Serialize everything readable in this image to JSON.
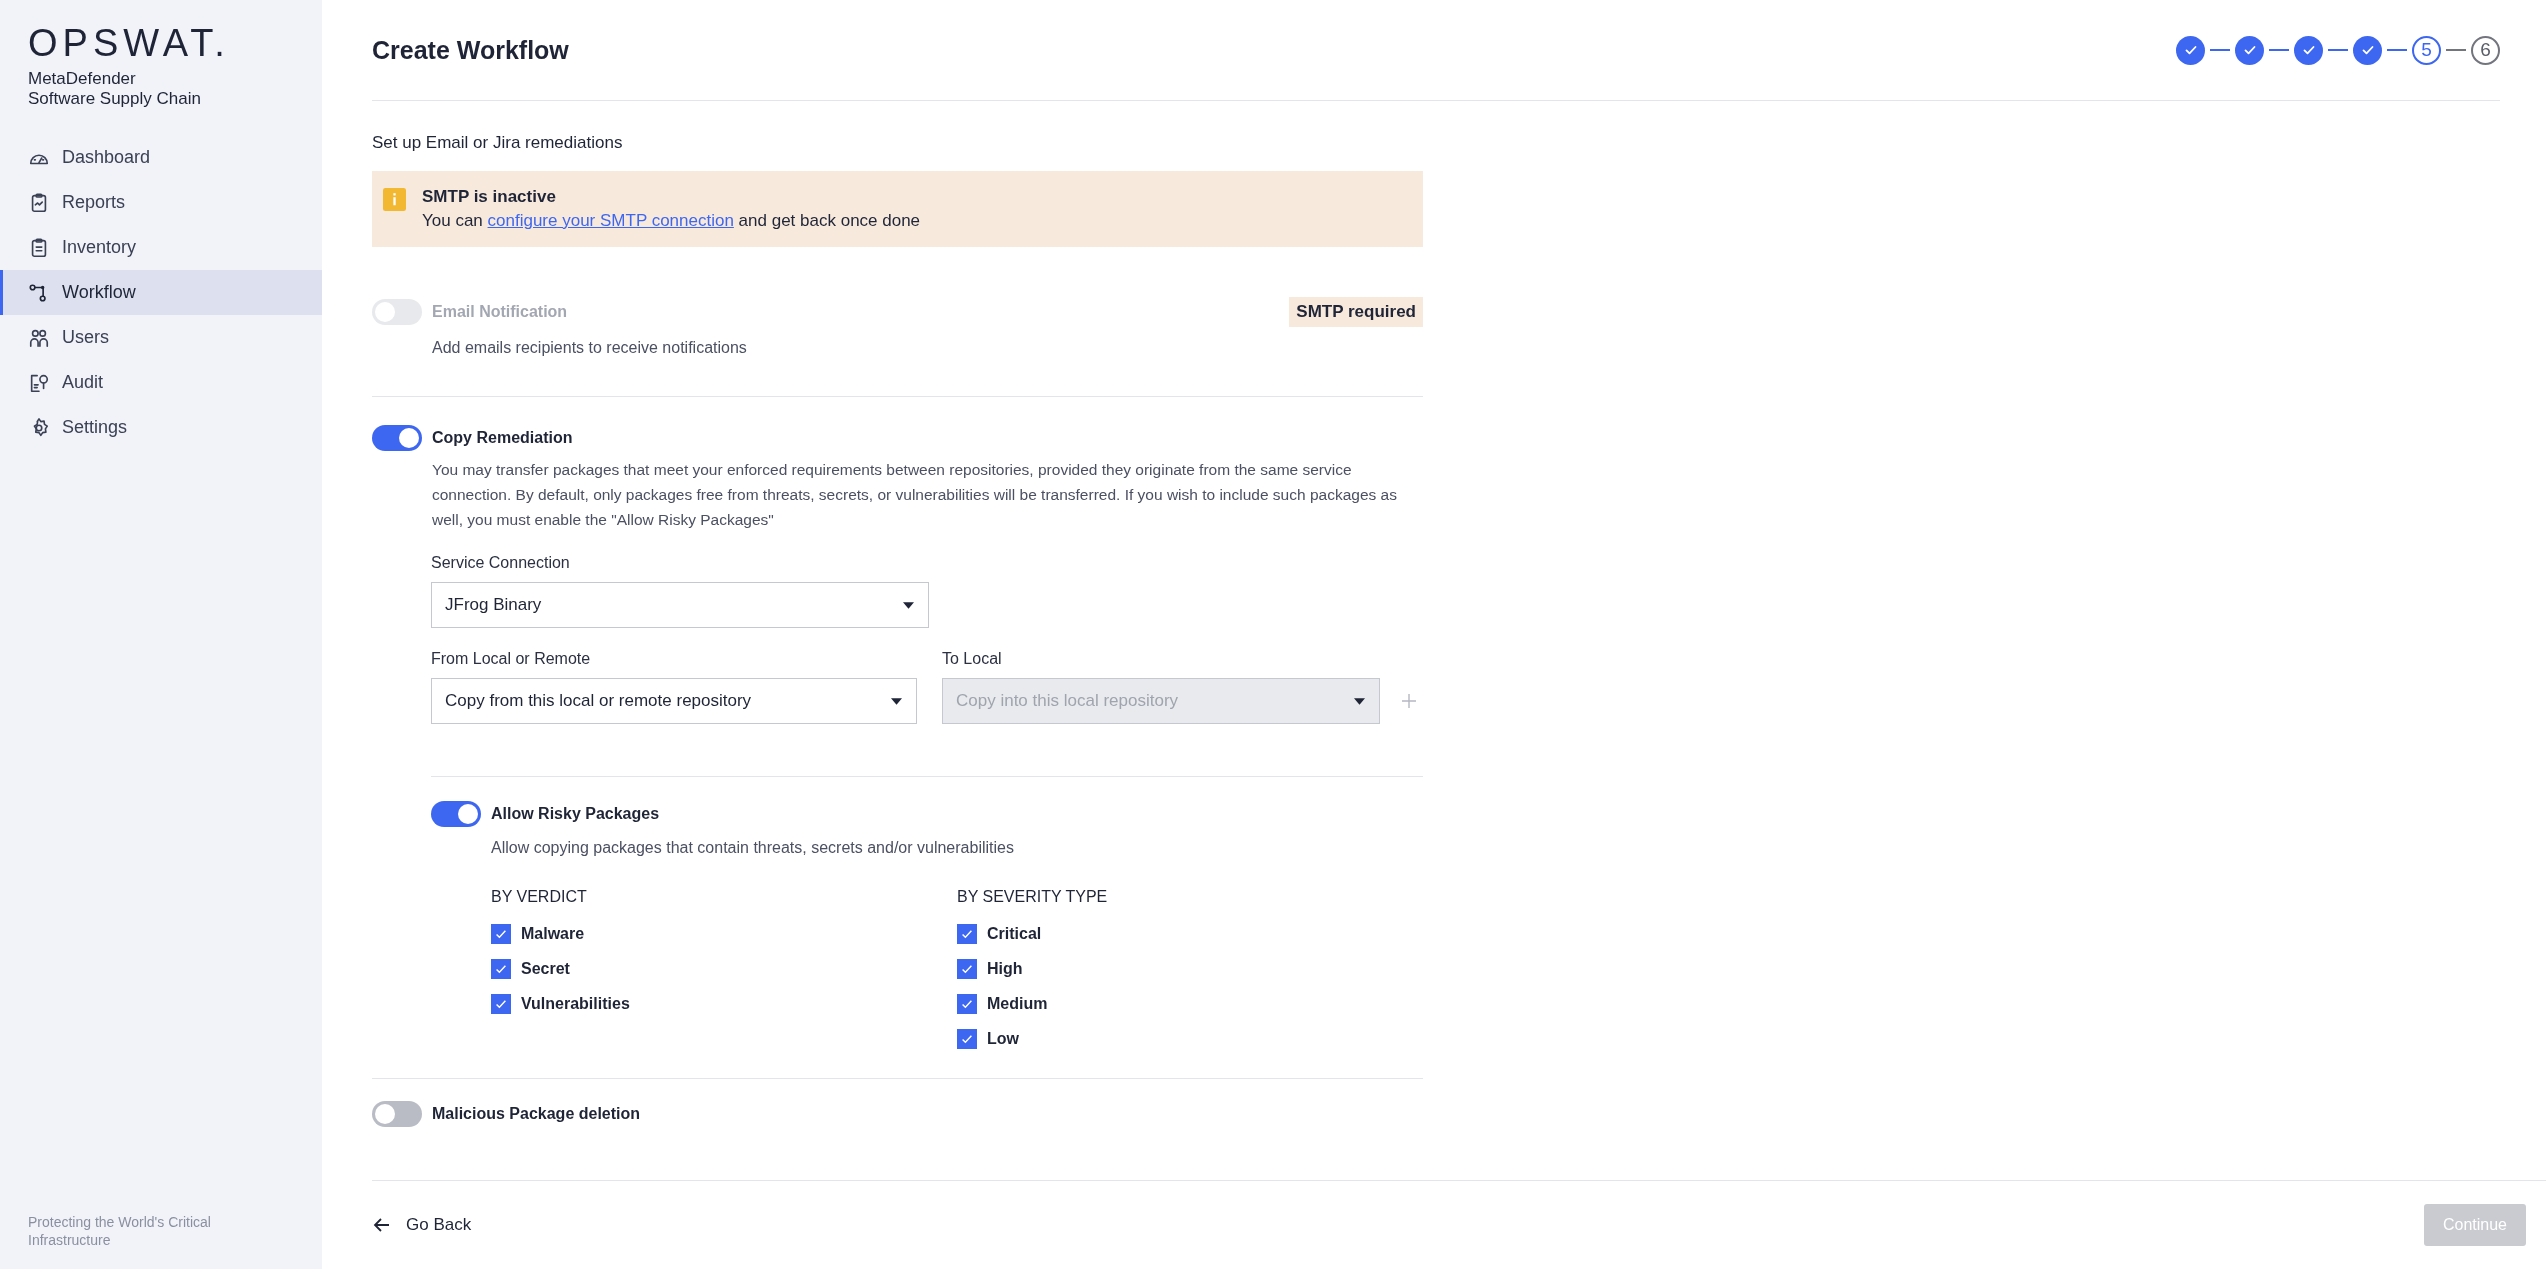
{
  "sidebar": {
    "logo": "OPSWAT.",
    "product": "MetaDefender",
    "subtitle": "Software Supply Chain",
    "items": [
      {
        "label": "Dashboard",
        "selected": false
      },
      {
        "label": "Reports",
        "selected": false
      },
      {
        "label": "Inventory",
        "selected": false
      },
      {
        "label": "Workflow",
        "selected": true
      },
      {
        "label": "Users",
        "selected": false
      },
      {
        "label": "Audit",
        "selected": false
      },
      {
        "label": "Settings",
        "selected": false
      }
    ],
    "footer": "Protecting the World's Critical Infrastructure"
  },
  "header": {
    "title": "Create Workflow"
  },
  "stepper": [
    {
      "completed": true,
      "active": false
    },
    {
      "completed": true,
      "active": false
    },
    {
      "completed": true,
      "active": false
    },
    {
      "completed": true,
      "active": false
    },
    {
      "label": "5",
      "completed": false,
      "active": true
    },
    {
      "label": "6",
      "completed": false,
      "active": false
    }
  ],
  "intro": "Set up Email or Jira remediations",
  "alert": {
    "title": "SMTP is inactive",
    "text_before": "You can",
    "link": "configure your SMTP connection",
    "text_after": "and get back once done"
  },
  "email": {
    "label": "Email Notification",
    "on": false,
    "disabled": true,
    "description": "Add emails recipients to receive notifications",
    "badge": "SMTP required"
  },
  "copy": {
    "label": "Copy Remediation",
    "on": true,
    "disabled": false,
    "description": "You may transfer packages that meet your enforced requirements between repositories, provided they originate from the same service connection. By default, only packages free from threats, secrets, or vulnerabilities will be transferred. If you wish to include such packages as well, you must enable the \"Allow Risky Packages\"",
    "service": {
      "label": "Service Connection",
      "value": "JFrog Binary",
      "disabled": false
    },
    "from": {
      "label": "From Local or Remote",
      "value": "Copy from this local or remote repository",
      "disabled": false
    },
    "to": {
      "label": "To Local",
      "placeholder": "Copy into this local repository",
      "disabled": true
    },
    "risky": {
      "label": "Allow Risky Packages",
      "on": true,
      "disabled": false,
      "description": "Allow copying packages that contain threats, secrets and/or vulnerabilities",
      "groups": [
        {
          "title": "BY VERDICT",
          "options": [
            {
              "label": "Malware",
              "checked": true
            },
            {
              "label": "Secret",
              "checked": true
            },
            {
              "label": "Vulnerabilities",
              "checked": true
            }
          ]
        },
        {
          "title": "BY SEVERITY TYPE",
          "options": [
            {
              "label": "Critical",
              "checked": true
            },
            {
              "label": "High",
              "checked": true
            },
            {
              "label": "Medium",
              "checked": true
            },
            {
              "label": "Low",
              "checked": true
            }
          ]
        }
      ]
    }
  },
  "malicious": {
    "label": "Malicious Package deletion",
    "on": false,
    "disabled": false
  },
  "footer": {
    "back": "Go Back",
    "continue": "Continue",
    "continue_disabled": true
  }
}
